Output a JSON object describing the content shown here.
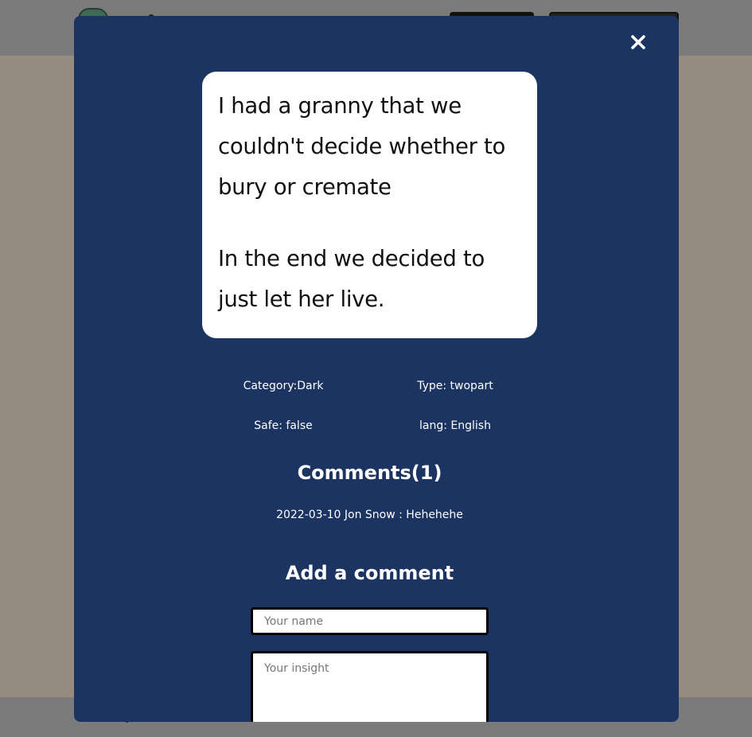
{
  "modal": {
    "close_label": "✕",
    "joke": {
      "setup": "I had a granny that we couldn't decide whether to bury or cremate",
      "delivery": "In the end we decided to just let her live."
    },
    "meta": {
      "category": "Category:Dark",
      "type": "Type: twopart",
      "safe": "Safe: false",
      "lang": "lang: English"
    },
    "comments_title": "Comments(1)",
    "comments": [
      {
        "text": "2022-03-10 Jon Snow : Hehehehe"
      }
    ],
    "add_comment_title": "Add a comment",
    "form": {
      "name_placeholder": "Your name",
      "insight_placeholder": "Your insight"
    }
  },
  "colors": {
    "modal_bg": "#1c3461",
    "overlay_bg": "#958b81",
    "card_bg": "#ffffff"
  },
  "icons": {
    "close": "close-icon"
  }
}
